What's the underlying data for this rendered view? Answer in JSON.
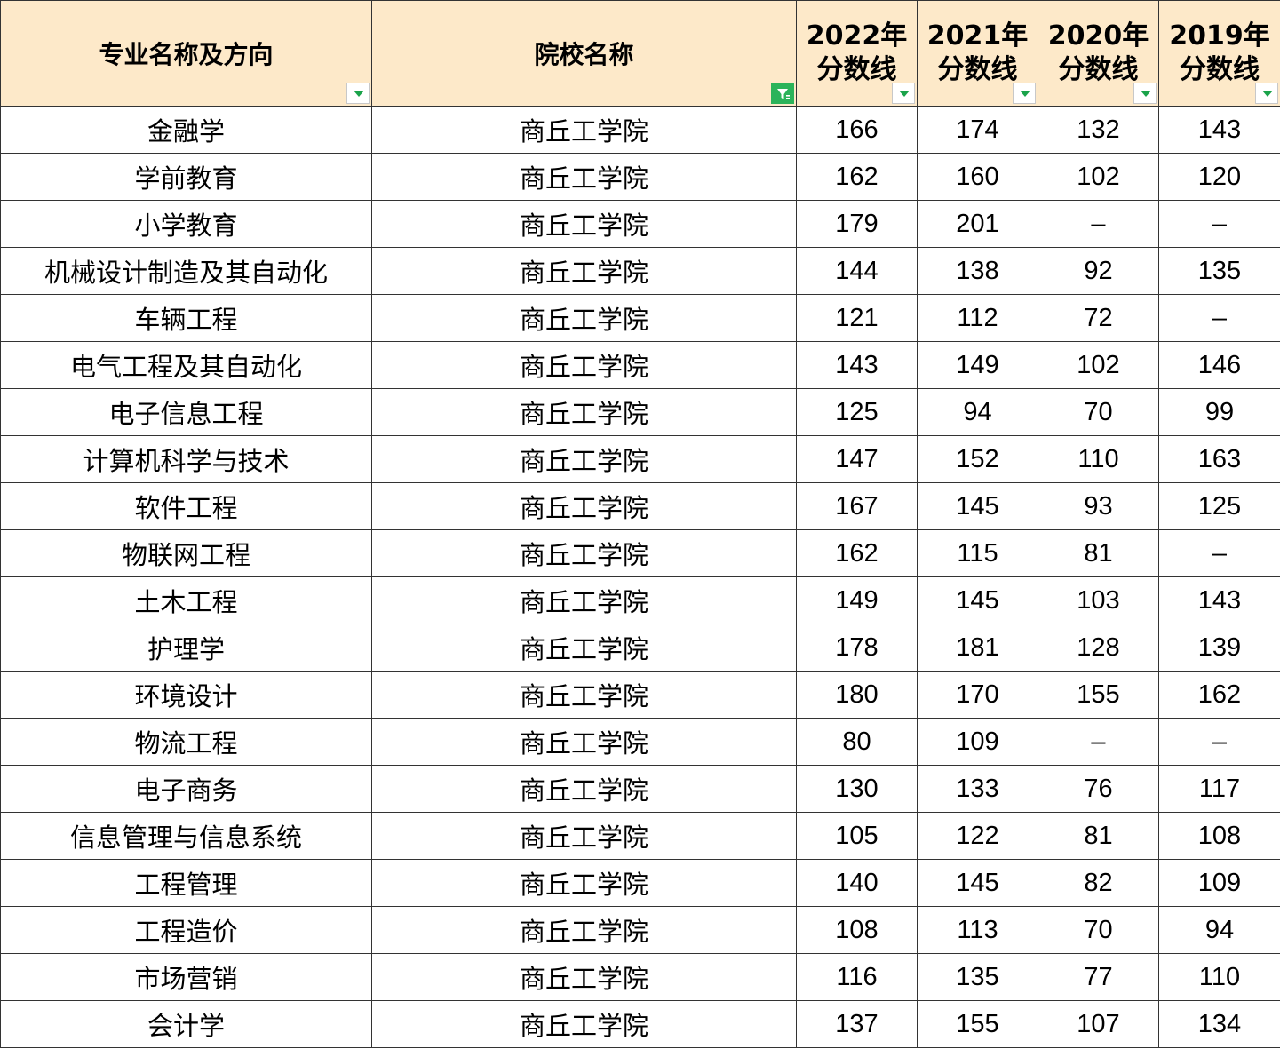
{
  "header": {
    "major": "专业名称及方向",
    "school": "院校名称",
    "years": [
      {
        "year": "2022年",
        "label": "分数线"
      },
      {
        "year": "2021年",
        "label": "分数线"
      },
      {
        "year": "2020年",
        "label": "分数线"
      },
      {
        "year": "2019年",
        "label": "分数线"
      }
    ]
  },
  "filters": {
    "active_column": "院校名称",
    "dropdown_icon": "chevron-down-icon",
    "active_icon": "filter-funnel-icon",
    "active_color": "#2bb35a",
    "dropdown_color": "#1aa34a",
    "header_bg": "#fde9c9"
  },
  "rows": [
    {
      "major": "金融学",
      "school": "商丘工学院",
      "y2022": "166",
      "y2021": "174",
      "y2020": "132",
      "y2019": "143"
    },
    {
      "major": "学前教育",
      "school": "商丘工学院",
      "y2022": "162",
      "y2021": "160",
      "y2020": "102",
      "y2019": "120"
    },
    {
      "major": "小学教育",
      "school": "商丘工学院",
      "y2022": "179",
      "y2021": "201",
      "y2020": "–",
      "y2019": "–"
    },
    {
      "major": "机械设计制造及其自动化",
      "school": "商丘工学院",
      "y2022": "144",
      "y2021": "138",
      "y2020": "92",
      "y2019": "135"
    },
    {
      "major": "车辆工程",
      "school": "商丘工学院",
      "y2022": "121",
      "y2021": "112",
      "y2020": "72",
      "y2019": "–"
    },
    {
      "major": "电气工程及其自动化",
      "school": "商丘工学院",
      "y2022": "143",
      "y2021": "149",
      "y2020": "102",
      "y2019": "146"
    },
    {
      "major": "电子信息工程",
      "school": "商丘工学院",
      "y2022": "125",
      "y2021": "94",
      "y2020": "70",
      "y2019": "99"
    },
    {
      "major": "计算机科学与技术",
      "school": "商丘工学院",
      "y2022": "147",
      "y2021": "152",
      "y2020": "110",
      "y2019": "163"
    },
    {
      "major": "软件工程",
      "school": "商丘工学院",
      "y2022": "167",
      "y2021": "145",
      "y2020": "93",
      "y2019": "125"
    },
    {
      "major": "物联网工程",
      "school": "商丘工学院",
      "y2022": "162",
      "y2021": "115",
      "y2020": "81",
      "y2019": "–"
    },
    {
      "major": "土木工程",
      "school": "商丘工学院",
      "y2022": "149",
      "y2021": "145",
      "y2020": "103",
      "y2019": "143"
    },
    {
      "major": "护理学",
      "school": "商丘工学院",
      "y2022": "178",
      "y2021": "181",
      "y2020": "128",
      "y2019": "139"
    },
    {
      "major": "环境设计",
      "school": "商丘工学院",
      "y2022": "180",
      "y2021": "170",
      "y2020": "155",
      "y2019": "162"
    },
    {
      "major": "物流工程",
      "school": "商丘工学院",
      "y2022": "80",
      "y2021": "109",
      "y2020": "–",
      "y2019": "–"
    },
    {
      "major": "电子商务",
      "school": "商丘工学院",
      "y2022": "130",
      "y2021": "133",
      "y2020": "76",
      "y2019": "117"
    },
    {
      "major": "信息管理与信息系统",
      "school": "商丘工学院",
      "y2022": "105",
      "y2021": "122",
      "y2020": "81",
      "y2019": "108"
    },
    {
      "major": "工程管理",
      "school": "商丘工学院",
      "y2022": "140",
      "y2021": "145",
      "y2020": "82",
      "y2019": "109"
    },
    {
      "major": "工程造价",
      "school": "商丘工学院",
      "y2022": "108",
      "y2021": "113",
      "y2020": "70",
      "y2019": "94"
    },
    {
      "major": "市场营销",
      "school": "商丘工学院",
      "y2022": "116",
      "y2021": "135",
      "y2020": "77",
      "y2019": "110"
    },
    {
      "major": "会计学",
      "school": "商丘工学院",
      "y2022": "137",
      "y2021": "155",
      "y2020": "107",
      "y2019": "134"
    }
  ]
}
